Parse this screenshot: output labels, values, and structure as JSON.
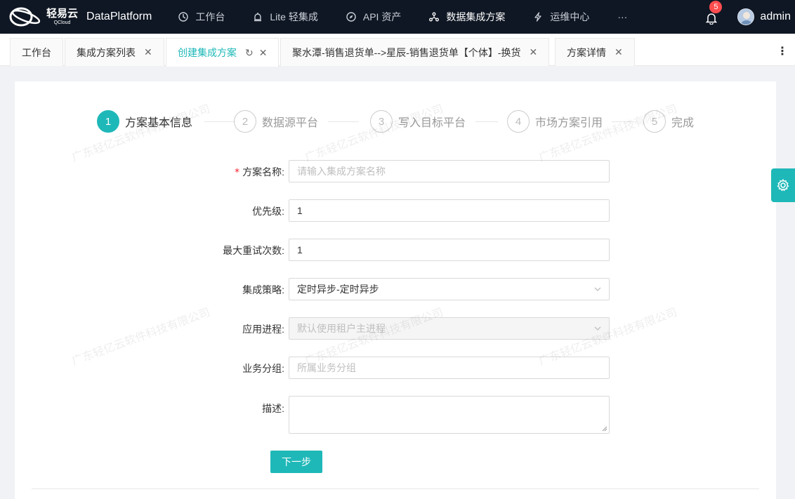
{
  "brand": {
    "logo_cn": "轻易云",
    "logo_en": "QCloud",
    "app_name": "DataPlatform"
  },
  "nav": {
    "items": [
      {
        "label": "工作台",
        "icon": "dashboard-icon"
      },
      {
        "label": "Lite 轻集成",
        "icon": "alarm-icon"
      },
      {
        "label": "API 资产",
        "icon": "compass-icon"
      },
      {
        "label": "数据集成方案",
        "icon": "cluster-icon"
      },
      {
        "label": "运维中心",
        "icon": "thunderbolt-icon"
      },
      {
        "label": "···",
        "icon": ""
      }
    ],
    "notification_count": "5",
    "user": "admin"
  },
  "tabs": [
    {
      "label": "工作台"
    },
    {
      "label": "集成方案列表"
    },
    {
      "label": "创建集成方案"
    },
    {
      "label": "聚水潭-销售退货单-->星辰-销售退货单【个体】-换货"
    },
    {
      "label": "方案详情"
    }
  ],
  "steps": [
    {
      "num": "1",
      "label": "方案基本信息"
    },
    {
      "num": "2",
      "label": "数据源平台"
    },
    {
      "num": "3",
      "label": "写入目标平台"
    },
    {
      "num": "4",
      "label": "市场方案引用"
    },
    {
      "num": "5",
      "label": "完成"
    }
  ],
  "form": {
    "name": {
      "label": "方案名称:",
      "placeholder": "请输入集成方案名称",
      "required": "*"
    },
    "priority": {
      "label": "优先级:",
      "value": "1"
    },
    "retry": {
      "label": "最大重试次数:",
      "value": "1"
    },
    "strategy": {
      "label": "集成策略:",
      "value": "定时异步-定时异步"
    },
    "process": {
      "label": "应用进程:",
      "placeholder": "默认使用租户主进程"
    },
    "group": {
      "label": "业务分组:",
      "placeholder": "所属业务分组"
    },
    "desc": {
      "label": "描述:"
    },
    "next_button": "下一步"
  },
  "watermark": "广东轻亿云软件科技有限公司",
  "colors": {
    "accent": "#1fb8b8",
    "nav_bg": "#0f1724",
    "badge": "#ff4d4f"
  }
}
